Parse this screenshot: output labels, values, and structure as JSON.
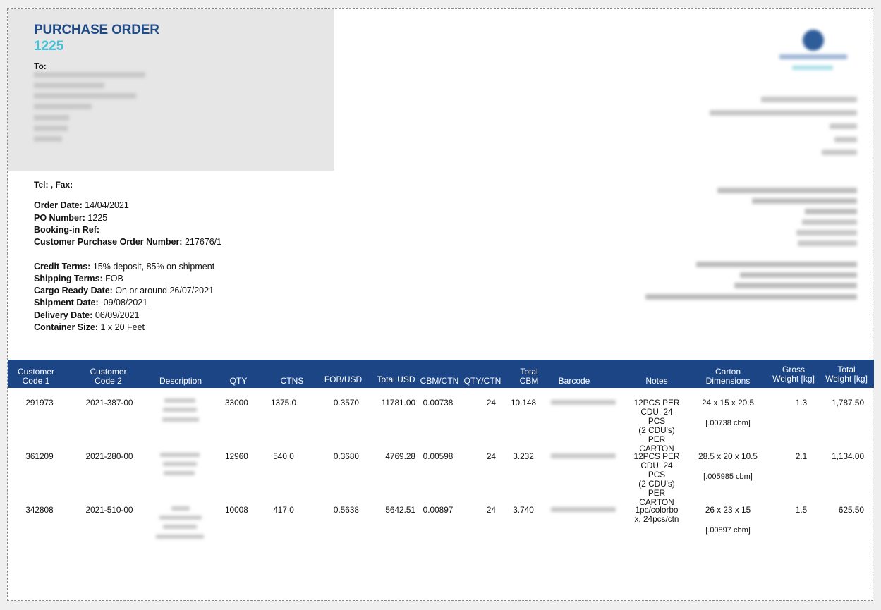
{
  "header": {
    "title": "PURCHASE ORDER",
    "po_number": "1225",
    "to_label": "To:"
  },
  "contact": {
    "tel_fax": "Tel: , Fax:"
  },
  "order_info": {
    "order_date_label": "Order Date:",
    "order_date": "14/04/2021",
    "po_number_label": "PO Number:",
    "po_number": "1225",
    "booking_ref_label": "Booking-in Ref:",
    "booking_ref": "",
    "customer_po_label": "Customer Purchase Order Number:",
    "customer_po": "217676/1"
  },
  "terms": {
    "credit_label": "Credit Terms:",
    "credit": "15% deposit, 85% on shipment",
    "shipping_label": "Shipping Terms:",
    "shipping": "FOB",
    "cargo_label": "Cargo Ready Date:",
    "cargo": "On or around 26/07/2021",
    "shipment_label": "Shipment Date:",
    "shipment": " 09/08/2021",
    "delivery_label": "Delivery Date:",
    "delivery": "06/09/2021",
    "container_label": "Container Size:",
    "container": "1 x 20 Feet"
  },
  "table": {
    "headers": {
      "cust1": [
        "Customer",
        "Code 1"
      ],
      "cust2": [
        "Customer",
        "Code 2"
      ],
      "description": "Description",
      "qty": "QTY",
      "ctns": "CTNS",
      "fob": "FOB/USD",
      "total_usd": "Total USD",
      "cbm_ctn": "CBM/CTN",
      "qty_ctn": "QTY/CTN",
      "total_cbm": [
        "Total",
        "CBM"
      ],
      "barcode": "Barcode",
      "notes": "Notes",
      "carton_dims": [
        "Carton",
        "Dimensions"
      ],
      "gross_weight": [
        "Gross",
        "Weight [kg]"
      ],
      "total_weight": [
        "Total",
        "Weight [kg]"
      ]
    },
    "rows": [
      {
        "cust1": "291973",
        "cust2": "2021-387-00",
        "qty": "33000",
        "ctns": "1375.0",
        "fob": "0.3570",
        "total_usd": "11781.00",
        "cbm_ctn": "0.00738",
        "qty_ctn": "24",
        "total_cbm": "10.148",
        "notes": [
          "12PCS PER",
          "CDU, 24 PCS",
          "(2 CDU's)",
          "PER CARTON"
        ],
        "dims": "24 x 15 x 20.5",
        "dims_cbm": "[.00738 cbm]",
        "gross": "1.3",
        "total_weight": "1,787.50"
      },
      {
        "cust1": "361209",
        "cust2": "2021-280-00",
        "qty": "12960",
        "ctns": "540.0",
        "fob": "0.3680",
        "total_usd": "4769.28",
        "cbm_ctn": "0.00598",
        "qty_ctn": "24",
        "total_cbm": "3.232",
        "notes": [
          "12PCS PER",
          "CDU, 24 PCS",
          "(2 CDU's)",
          "PER CARTON"
        ],
        "dims": "28.5 x 20 x 10.5",
        "dims_cbm": "[.005985 cbm]",
        "gross": "2.1",
        "total_weight": "1,134.00"
      },
      {
        "cust1": "342808",
        "cust2": "2021-510-00",
        "qty": "10008",
        "ctns": "417.0",
        "fob": "0.5638",
        "total_usd": "5642.51",
        "cbm_ctn": "0.00897",
        "qty_ctn": "24",
        "total_cbm": "3.740",
        "notes": [
          "1pc/colorbo",
          "x, 24pcs/ctn"
        ],
        "dims": "26 x 23 x 15",
        "dims_cbm": "[.00897 cbm]",
        "gross": "1.5",
        "total_weight": "625.50"
      }
    ]
  },
  "colors": {
    "title": "#1f4b86",
    "accent": "#46c1d8",
    "table_header": "#1c4585"
  }
}
